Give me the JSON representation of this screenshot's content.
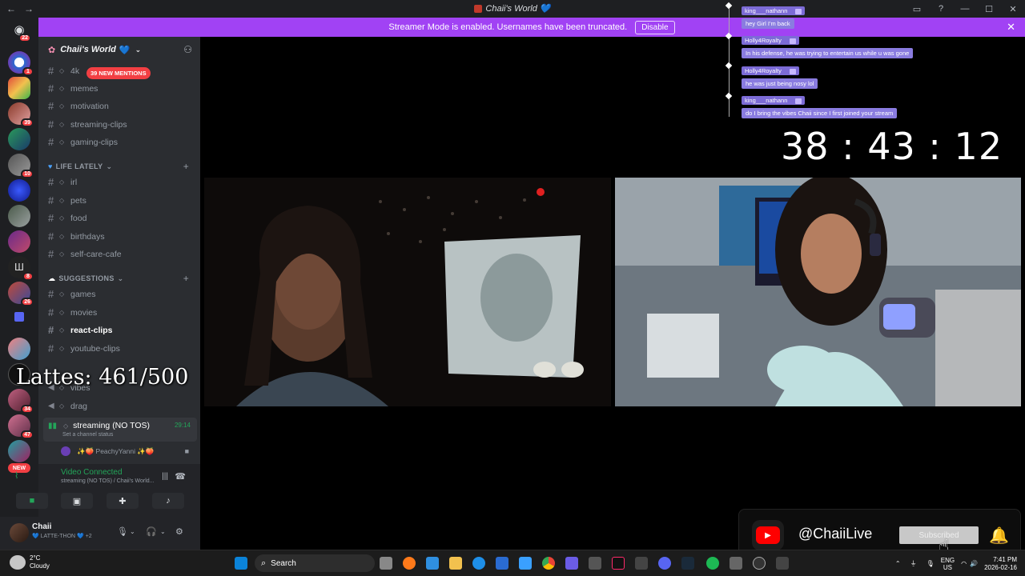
{
  "window": {
    "title": "Chaii's World",
    "title_heart": "💙"
  },
  "banner": {
    "text": "Streamer Mode is enabled. Usernames have been truncated.",
    "button": "Disable",
    "color": "#a142f4"
  },
  "server": {
    "name": "Chaii's World",
    "heart": "💙"
  },
  "mentions_badge": "39 NEW MENTIONS",
  "channels_top": [
    {
      "name": "4k"
    },
    {
      "name": "memes"
    },
    {
      "name": "motivation"
    },
    {
      "name": "streaming-clips"
    },
    {
      "name": "gaming-clips"
    }
  ],
  "category_life": "LIFE LATELY",
  "channels_life": [
    {
      "name": "irl"
    },
    {
      "name": "pets"
    },
    {
      "name": "food"
    },
    {
      "name": "birthdays"
    },
    {
      "name": "self-care-cafe"
    }
  ],
  "category_suggestions": "SUGGESTIONS",
  "channels_suggestions": [
    {
      "name": "games"
    },
    {
      "name": "movies"
    },
    {
      "name": "react-clips"
    },
    {
      "name": "youtube-clips"
    }
  ],
  "voice_channels": [
    {
      "name": "vibes"
    },
    {
      "name": "drag"
    }
  ],
  "live_voice": {
    "name": "streaming (NO TOS)",
    "timer": "29:14",
    "status": "Set a channel status"
  },
  "voice_user": {
    "name": "✨🍑 PeachyYanni ✨🍑"
  },
  "rail_badges": [
    "22",
    "1",
    "39",
    "10",
    "8",
    "26",
    "34",
    "47"
  ],
  "rail_new": "NEW",
  "voice_panel": {
    "title": "Video Connected",
    "subtitle": "streaming (NO TOS) / Chaii's World..."
  },
  "user_panel": {
    "name": "Chaii",
    "status": "💙 LATTE-THON 💙 +2"
  },
  "overlay": {
    "lattes": "Lattes: 461/500",
    "counter": "38 : 43 : 12"
  },
  "chat": [
    {
      "user": "king___nathann",
      "text": "hey Girl I'm back"
    },
    {
      "user": "Holly4Royalty",
      "text": "In his defense, he was trying to entertain us while u was gone"
    },
    {
      "user": "Holly4Royalty",
      "text": "he was just being nosy lol"
    },
    {
      "user": "king___nathann",
      "text": "do I bring the vibes Chaii since I first joined your stream"
    }
  ],
  "youtube": {
    "handle": "@ChaiiLive",
    "button": "Subscribed"
  },
  "taskbar": {
    "weather_temp": "2°C",
    "weather_desc": "Cloudy",
    "search": "Search",
    "lang_1": "ENG",
    "lang_2": "US",
    "time": "7:41 PM",
    "date": "2026-02-16"
  }
}
